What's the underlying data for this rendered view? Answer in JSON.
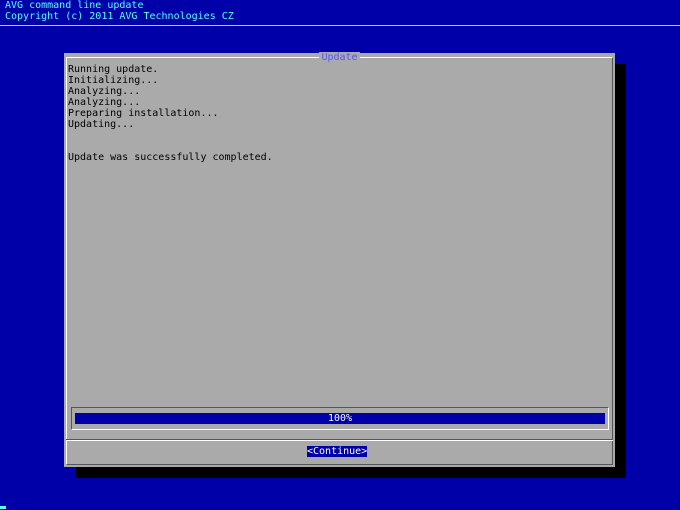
{
  "header": {
    "line1": "AVG command line update",
    "line2": "Copyright (c) 2011 AVG Technologies CZ"
  },
  "dialog": {
    "title": "Update",
    "log_lines": [
      "Running update.",
      "Initializing...",
      "Analyzing...",
      "Analyzing...",
      "Preparing installation...",
      "Updating...",
      "",
      "",
      "Update was successfully completed."
    ],
    "progress": {
      "percent": 100,
      "label": "100%"
    },
    "continue_label": "<Continue>"
  },
  "colors": {
    "background": "#0000a8",
    "header_text": "#55ffff",
    "dialog_bg": "#aaaaaa",
    "title_text": "#5555ff",
    "gauge_fill": "#0000a8",
    "shadow": "#000000"
  }
}
